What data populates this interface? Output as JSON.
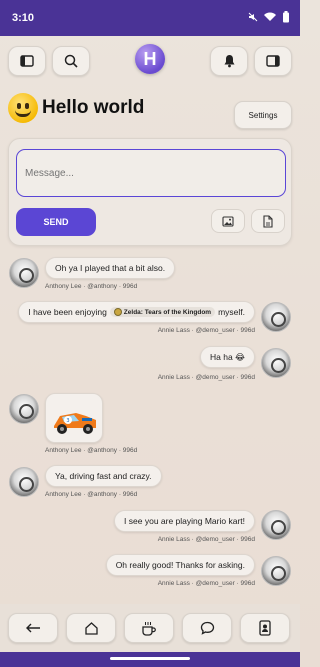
{
  "status_bar": {
    "time": "3:10",
    "icons": [
      "mute-icon",
      "wifi-icon",
      "battery-icon"
    ]
  },
  "top_nav": {
    "left_buttons": [
      "sidebar-left-icon",
      "search-icon"
    ],
    "logo_letter": "H",
    "right_buttons": [
      "bell-icon",
      "sidebar-right-icon"
    ]
  },
  "header": {
    "greeting": "Hello world",
    "emoji": "grinning-face",
    "settings_label": "Settings"
  },
  "composer": {
    "placeholder": "Message...",
    "value": "",
    "send_label": "SEND",
    "attach_icons": [
      "image-icon",
      "file-icon"
    ]
  },
  "messages": [
    {
      "side": "left",
      "text": "Oh ya I played that a bit also.",
      "author": "Anthony Lee · @anthony · 996d"
    },
    {
      "side": "right",
      "text_before": "I have been enjoying",
      "chip": "Zelda: Tears of the Kingdom",
      "text_after": "myself.",
      "author": "Annie Lass · @demo_user · 996d"
    },
    {
      "side": "right",
      "text": "Ha ha 😂",
      "author": "Annie Lass · @demo_user · 996d"
    },
    {
      "side": "left",
      "image": "race-car-emoji",
      "author": "Anthony Lee · @anthony · 996d"
    },
    {
      "side": "left",
      "text": "Ya, driving fast and crazy.",
      "author": "Anthony Lee · @anthony · 996d"
    },
    {
      "side": "right",
      "text": "I see you are playing Mario kart!",
      "author": "Annie Lass · @demo_user · 996d"
    },
    {
      "side": "right",
      "text": "Oh really good! Thanks for asking.",
      "author": "Annie Lass · @demo_user · 996d"
    }
  ],
  "bottom_nav": [
    "back-arrow-icon",
    "home-icon",
    "coffee-icon",
    "chat-bubble-icon",
    "contact-card-icon"
  ],
  "colors": {
    "accent": "#5b46d4",
    "status_bar": "#4a3396",
    "background": "#ebe4dc"
  }
}
